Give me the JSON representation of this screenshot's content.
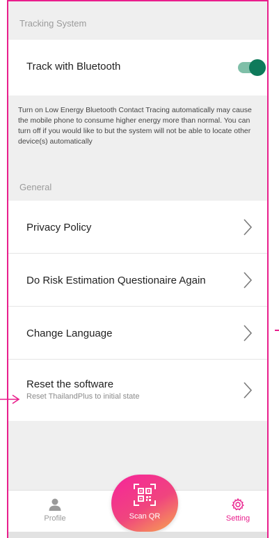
{
  "sections": {
    "tracking_header": "Tracking System",
    "general_header": "General"
  },
  "tracking": {
    "bluetooth_label": "Track with Bluetooth",
    "bluetooth_enabled": true,
    "info": "Turn on Low Energy Bluetooth Contact Tracing automatically may cause the mobile phone to consume higher energy more than normal. You can turn off if you would like to but the system will not be able to locate other device(s) automatically"
  },
  "general": {
    "items": [
      {
        "label": "Privacy Policy"
      },
      {
        "label": "Do Risk Estimation Questionaire Again"
      },
      {
        "label": "Change Language"
      },
      {
        "label": "Reset the software",
        "sublabel": "Reset ThailandPlus to initial state"
      }
    ]
  },
  "nav": {
    "profile": "Profile",
    "scan": "Scan QR",
    "setting": "Setting"
  },
  "colors": {
    "accent": "#e91e8c",
    "toggle_on": "#0f7a5b",
    "toggle_track": "#7fbfa8"
  },
  "icons": {
    "profile": "person-icon",
    "scan": "qr-scan-icon",
    "setting": "gear-icon",
    "chevron": "chevron-right-icon"
  }
}
